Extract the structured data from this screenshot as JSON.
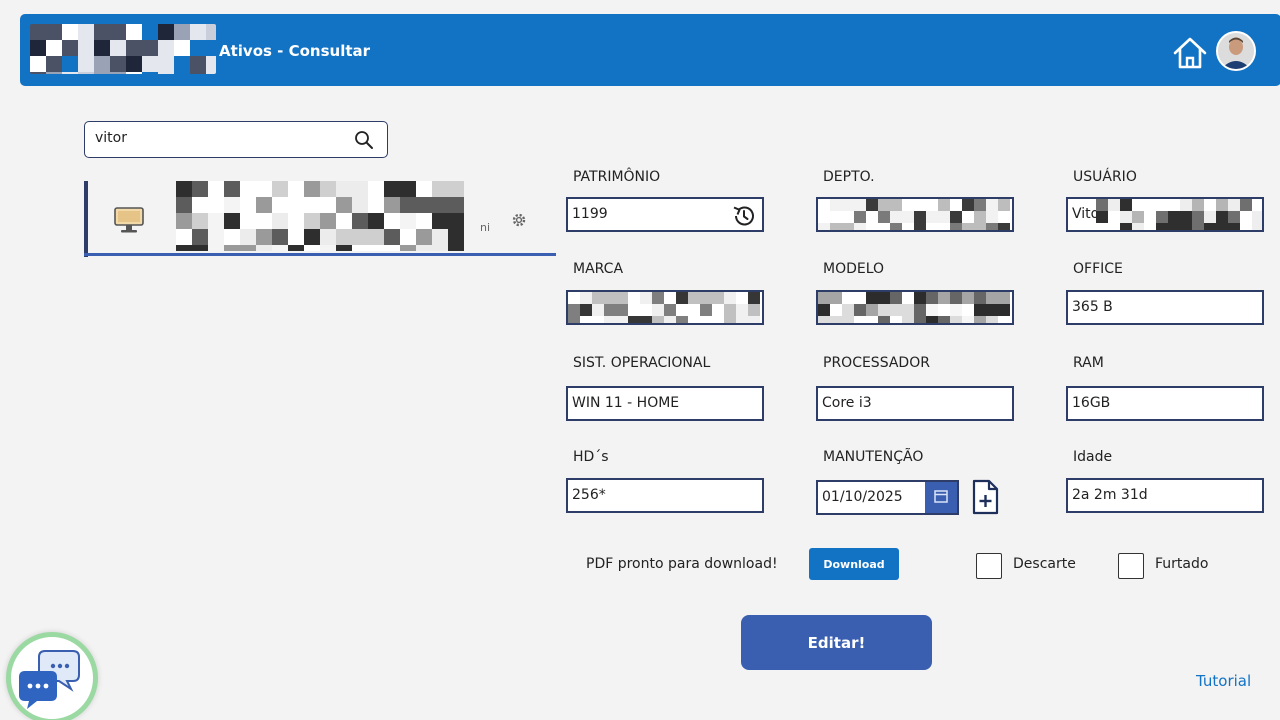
{
  "header": {
    "title": "Ativos - Consultar"
  },
  "search": {
    "value": "vitor"
  },
  "result": {
    "suffix": "ni"
  },
  "fields": {
    "patrimonio": {
      "label": "PATRIMÔNIO",
      "value": "1199"
    },
    "depto": {
      "label": "DEPTO.",
      "value": ""
    },
    "usuario": {
      "label": "USUÁRIO",
      "value": "Vito"
    },
    "marca": {
      "label": "MARCA",
      "value": ""
    },
    "modelo": {
      "label": "MODELO",
      "value": ""
    },
    "office": {
      "label": "OFFICE",
      "value": "365 B"
    },
    "so": {
      "label": "SIST. OPERACIONAL",
      "value": "WIN 11 - HOME"
    },
    "processador": {
      "label": "PROCESSADOR",
      "value": "Core i3"
    },
    "ram": {
      "label": "RAM",
      "value": "16GB"
    },
    "hds": {
      "label": "HD´s",
      "value": "256*"
    },
    "manutencao": {
      "label": "MANUTENÇÃO",
      "value": "01/10/2025"
    },
    "idade": {
      "label": "Idade",
      "value": "2a 2m 31d"
    }
  },
  "pdf": {
    "message": "PDF pronto para download!",
    "download_label": "Download"
  },
  "checkboxes": {
    "descarte": "Descarte",
    "furtado": "Furtado"
  },
  "actions": {
    "edit_label": "Editar!",
    "tutorial_label": "Tutorial"
  },
  "colors": {
    "header": "#1273c5",
    "accent": "#3a5fb0",
    "border": "#2e3d68",
    "background": "#f3f3f3"
  },
  "icons": {
    "home": "home-icon",
    "avatar": "avatar",
    "search": "search-icon",
    "monitor": "monitor-icon",
    "gear": "gear-icon",
    "history": "history-icon",
    "calendar": "calendar-icon",
    "add_file": "add-file-icon",
    "chat": "chat-icon"
  }
}
